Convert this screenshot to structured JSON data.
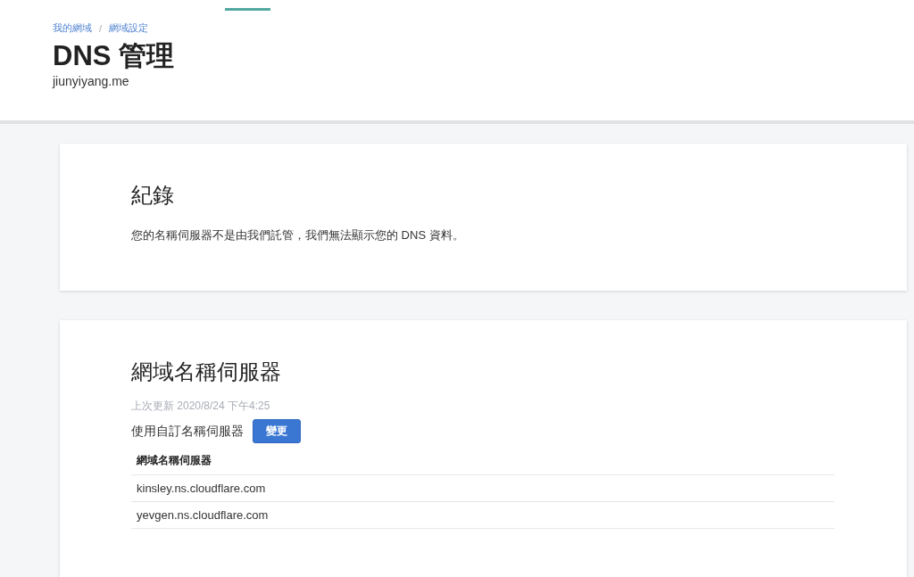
{
  "breadcrumbs": [
    "我的網域",
    "網域設定"
  ],
  "breadcrumb_separator": "/",
  "header": {
    "title": "DNS 管理",
    "subtitle": "jiunyiyang.me"
  },
  "records_card": {
    "title": "紀錄",
    "message": "您的名稱伺服器不是由我們託管，我們無法顯示您的 DNS 資料。"
  },
  "nameservers_card": {
    "title": "網域名稱伺服器",
    "last_updated": "上次更新 2020/8/24 下午4:25",
    "mode_label": "使用自訂名稱伺服器",
    "change_button": "變更",
    "table": {
      "columns": [
        "網域名稱伺服器"
      ],
      "rows": [
        [
          "kinsley.ns.cloudflare.com"
        ],
        [
          "yevgen.ns.cloudflare.com"
        ]
      ]
    }
  }
}
